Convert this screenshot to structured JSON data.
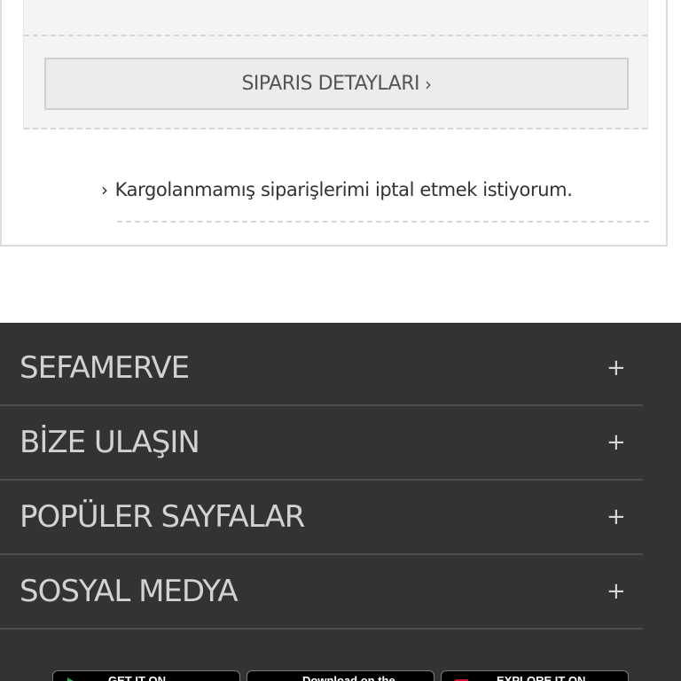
{
  "order": {
    "details_button": "SIPARIS DETAYLARI",
    "details_chevron": "›",
    "cancel_chevron": "›",
    "cancel_link": "Kargolanmamış siparişlerimi iptal etmek istiyorum."
  },
  "footer": {
    "sections": [
      {
        "label": "SEFAMERVE",
        "toggle": "+"
      },
      {
        "label": "BİZE ULAŞIN",
        "toggle": "+"
      },
      {
        "label": "POPÜLER SAYFALAR",
        "toggle": "+"
      },
      {
        "label": "SOSYAL MEDYA",
        "toggle": "+"
      }
    ],
    "store_badges": [
      {
        "text": "GET IT ON",
        "icon": "google-play-icon"
      },
      {
        "text": "Download on the",
        "icon": "apple-icon"
      },
      {
        "text": "EXPLORE IT ON",
        "icon": "appgallery-icon"
      }
    ]
  },
  "colors": {
    "footer_bg": "#333333",
    "footer_text": "#d2d2d2",
    "button_bg": "#ececec"
  }
}
